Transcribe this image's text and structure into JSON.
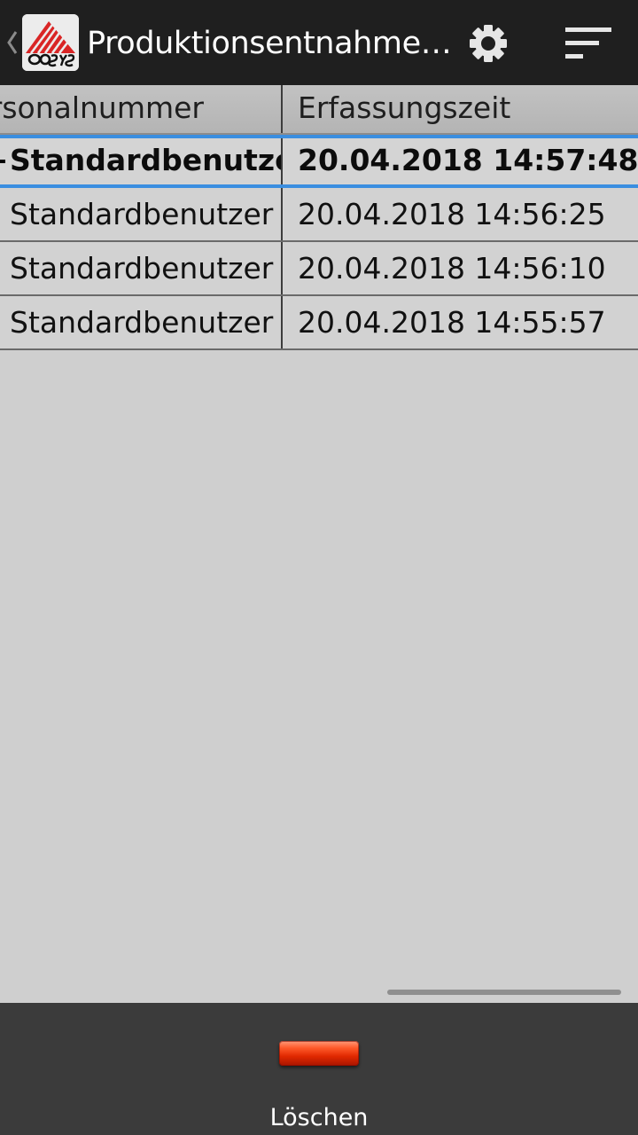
{
  "actionbar": {
    "title": "Produktionsentnahme…",
    "icons": {
      "up": "chevron-left-icon",
      "logo": "cosys-logo",
      "settings": "gear-icon",
      "sort": "sort-lines-icon"
    }
  },
  "table": {
    "columns": [
      "rsonalnummer",
      "Erfassungszeit"
    ],
    "rows": [
      {
        "personalnummer": "Standardbenutzer",
        "erfassungszeit": "20.04.2018 14:57:48",
        "selected": true
      },
      {
        "personalnummer": "Standardbenutzer",
        "erfassungszeit": "20.04.2018 14:56:25",
        "selected": false
      },
      {
        "personalnummer": "Standardbenutzer",
        "erfassungszeit": "20.04.2018 14:56:10",
        "selected": false
      },
      {
        "personalnummer": "Standardbenutzer",
        "erfassungszeit": "20.04.2018 14:55:57",
        "selected": false
      }
    ]
  },
  "bottombar": {
    "delete_label": "Löschen",
    "delete_icon": "minus-icon"
  },
  "colors": {
    "actionbar_bg": "#1f1f1f",
    "content_bg": "#cfcfcf",
    "selection": "#3a8ee0",
    "bottombar_bg": "#3b3b3b",
    "delete_red": "#e02800"
  }
}
